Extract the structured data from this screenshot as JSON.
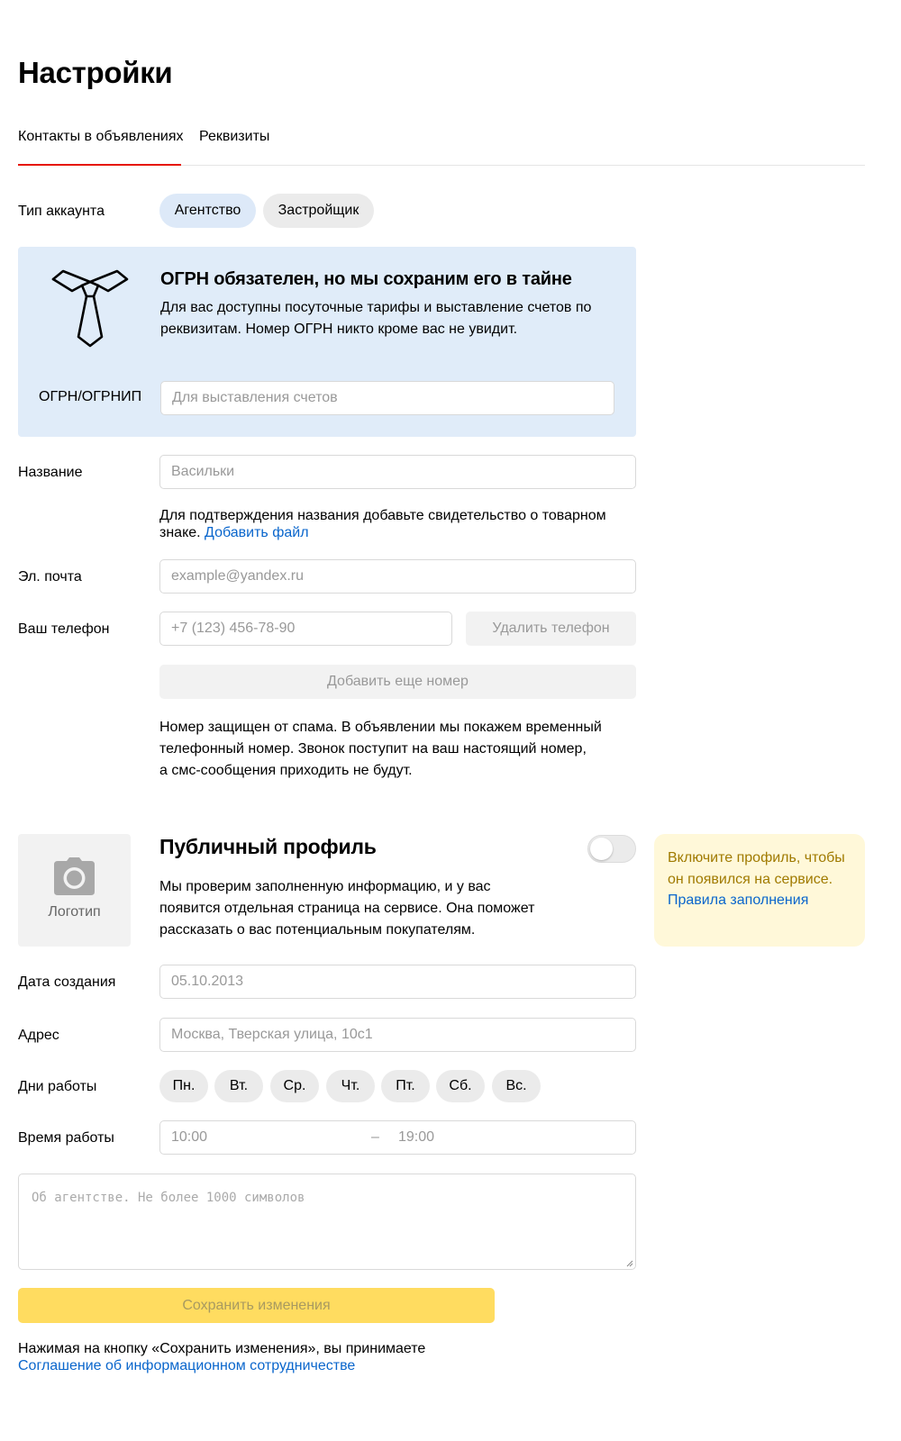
{
  "page": {
    "title": "Настройки"
  },
  "tabs": [
    {
      "label": "Контакты в объявлениях",
      "active": true
    },
    {
      "label": "Реквизиты",
      "active": false
    }
  ],
  "account_type": {
    "label": "Тип аккаунта",
    "options": [
      {
        "label": "Агентство",
        "selected": true
      },
      {
        "label": "Застройщик",
        "selected": false
      }
    ]
  },
  "ogrn_notice": {
    "icon": "tie-icon",
    "title": "ОГРН обязателен, но мы сохраним его в тайне",
    "text": "Для вас доступны посуточные тарифы и выставление счетов по реквизитам. Номер ОГРН никто кроме вас не увидит.",
    "field_label": "ОГРН/ОГРНИП",
    "placeholder": "Для выставления счетов"
  },
  "name_field": {
    "label": "Название",
    "placeholder": "Васильки",
    "hint": "Для подтверждения названия добавьте свидетельство о товарном знаке.",
    "hint_link": "Добавить файл"
  },
  "email_field": {
    "label": "Эл. почта",
    "placeholder": "example@yandex.ru"
  },
  "phone_field": {
    "label": "Ваш телефон",
    "placeholder": "+7 (123) 456-78-90",
    "delete_label": "Удалить телефон",
    "add_label": "Добавить еще номер",
    "spam_note_line1": "Номер защищен от спама. В объявлении мы покажем временный",
    "spam_note_line2": "телефонный номер. Звонок поступит на ваш настоящий номер,",
    "spam_note_line3": "а смс-сообщения приходить не будут."
  },
  "public_profile": {
    "logo_label": "Логотип",
    "logo_icon": "camera-icon",
    "title": "Публичный профиль",
    "enabled": false,
    "text_line1": "Мы проверим заполненную информацию, и у вас",
    "text_line2": "появится отдельная страница на сервисе. Она поможет",
    "text_line3": "рассказать о вас потенциальным покупателям.",
    "tip_text": "Включите профиль, чтобы он появился на сервисе.",
    "tip_link": "Правила заполнения"
  },
  "creation_date": {
    "label": "Дата создания",
    "placeholder": "05.10.2013"
  },
  "address": {
    "label": "Адрес",
    "placeholder": "Москва, Тверская улица, 10с1"
  },
  "work_days": {
    "label": "Дни работы",
    "days": [
      "Пн.",
      "Вт.",
      "Ср.",
      "Чт.",
      "Пт.",
      "Сб.",
      "Вс."
    ]
  },
  "work_time": {
    "label": "Время работы",
    "from_placeholder": "10:00",
    "separator": "–",
    "to_placeholder": "19:00"
  },
  "about": {
    "placeholder": "Об агентстве. Не более 1000 символов"
  },
  "save": {
    "label": "Сохранить изменения",
    "agreement_text": "Нажимая на кнопку «Сохранить изменения», вы принимаете",
    "agreement_link": "Соглашение об информационном сотрудничестве"
  },
  "colors": {
    "accent_red": "#e61400",
    "link_blue": "#0a66cc",
    "notice_blue": "#e0ecf9",
    "save_yellow": "#ffdc60",
    "tip_yellow": "#fff8d9"
  }
}
